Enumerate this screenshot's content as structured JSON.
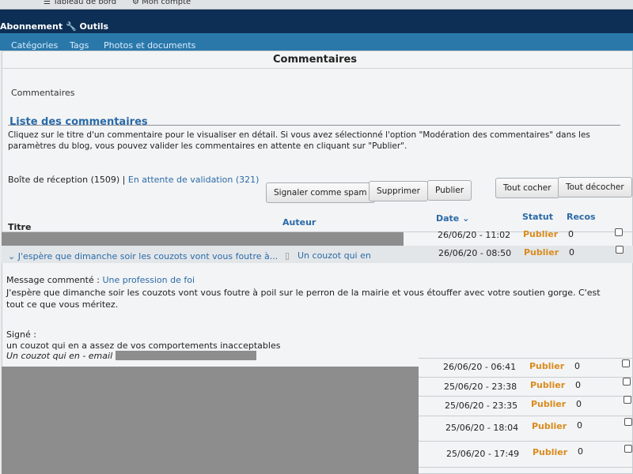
{
  "top_nav": {
    "dashboard": "Tableau de bord",
    "account": "Mon compte"
  },
  "navbar": {
    "subscription": "Abonnement",
    "tools": "Outils"
  },
  "subnav": {
    "categories": "Catégories",
    "tags": "Tags",
    "photos": "Photos et documents"
  },
  "page": {
    "title": "Commentaires",
    "breadcrumb": "Commentaires",
    "section_title": "Liste des commentaires",
    "help_text": "Cliquez sur le titre d'un commentaire pour le visualiser en détail. Si vous avez sélectionné l'option \"Modération des commentaires\" dans les paramètres du blog, vous pouvez valider les commentaires en attente en cliquant sur \"Publier\"."
  },
  "filters": {
    "inbox": "Boîte de réception (1509)",
    "separator": "|",
    "pending": "En attente de validation (321)"
  },
  "buttons": {
    "spam": "Signaler comme spam",
    "delete": "Supprimer",
    "publish": "Publier",
    "check_all": "Tout cocher",
    "uncheck_all": "Tout décocher"
  },
  "table": {
    "headers": {
      "title": "Titre",
      "author": "Auteur",
      "date": "Date ⌄",
      "status": "Statut",
      "recos": "Recos"
    },
    "rows": [
      {
        "date": "26/06/20 - 11:02",
        "status": "Publier",
        "recos": "0"
      },
      {
        "title": "⌄ J'espère que dimanche soir les couzots vont vous foutre à...",
        "author": "Un couzot qui en",
        "date": "26/06/20 - 08:50",
        "status": "Publier",
        "recos": "0"
      },
      {
        "date": "26/06/20 - 06:41",
        "status": "Publier",
        "recos": "0"
      },
      {
        "date": "25/06/20 - 23:38",
        "status": "Publier",
        "recos": "0"
      },
      {
        "date": "25/06/20 - 23:35",
        "status": "Publier",
        "recos": "0"
      },
      {
        "date": "25/06/20 - 18:04",
        "status": "Publier",
        "recos": "0"
      },
      {
        "date": "25/06/20 - 17:49",
        "status": "Publier",
        "recos": "0"
      }
    ]
  },
  "detail": {
    "commented_label": "Message commenté :",
    "commented_link": "Une profession de foi",
    "body": "J'espère que dimanche soir les couzots vont vous foutre à poil sur le perron de la mairie et vous étouffer avec votre soutien gorge. C'est tout ce que vous méritez.",
    "signed_label": "Signé :",
    "signed_text": "un couzot qui en a assez de vos comportements inacceptables",
    "email_label": "Un couzot qui en - email :"
  },
  "colors": {
    "navbar": "#0e2f55",
    "subnav": "#2a78aa",
    "link": "#2a6aa8",
    "status": "#d98b1d"
  }
}
